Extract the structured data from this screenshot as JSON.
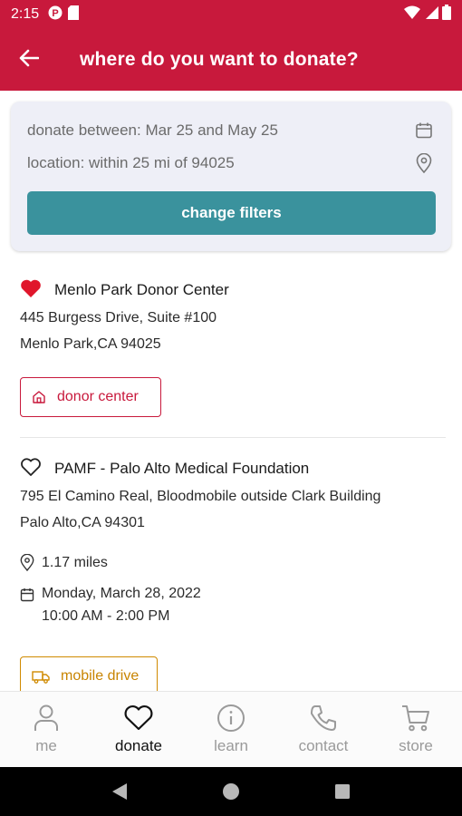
{
  "status_bar": {
    "time": "2:15",
    "background": "#c8193c"
  },
  "app_bar": {
    "title": "where do you want to donate?",
    "back_icon": "arrow-left-icon"
  },
  "filters": {
    "date_text": "donate between: Mar 25 and May 25",
    "location_text": "location: within 25 mi of 94025",
    "button_label": "change filters",
    "button_color": "#3a929d"
  },
  "centers": [
    {
      "name": "Menlo Park Donor Center",
      "favorited": true,
      "address_line1": "445 Burgess Drive, Suite #100",
      "address_line2": "Menlo Park,CA 94025",
      "type_label": "donor center",
      "type_icon": "home-icon"
    },
    {
      "name": "PAMF - Palo Alto Medical Foundation",
      "favorited": false,
      "address_line1": "795 El Camino Real, Bloodmobile outside Clark Building",
      "address_line2": "Palo Alto,CA 94301",
      "distance": "1.17 miles",
      "date": "Monday, March 28, 2022",
      "time": "10:00 AM - 2:00 PM",
      "type_label": "mobile drive",
      "type_icon": "truck-icon"
    }
  ],
  "bottom_nav": [
    {
      "label": "me",
      "icon": "person-icon",
      "active": false
    },
    {
      "label": "donate",
      "icon": "heart-icon",
      "active": true
    },
    {
      "label": "learn",
      "icon": "info-icon",
      "active": false
    },
    {
      "label": "contact",
      "icon": "phone-icon",
      "active": false
    },
    {
      "label": "store",
      "icon": "cart-icon",
      "active": false
    }
  ],
  "colors": {
    "brand_red": "#c8193c",
    "mobile_orange": "#d08a00"
  }
}
